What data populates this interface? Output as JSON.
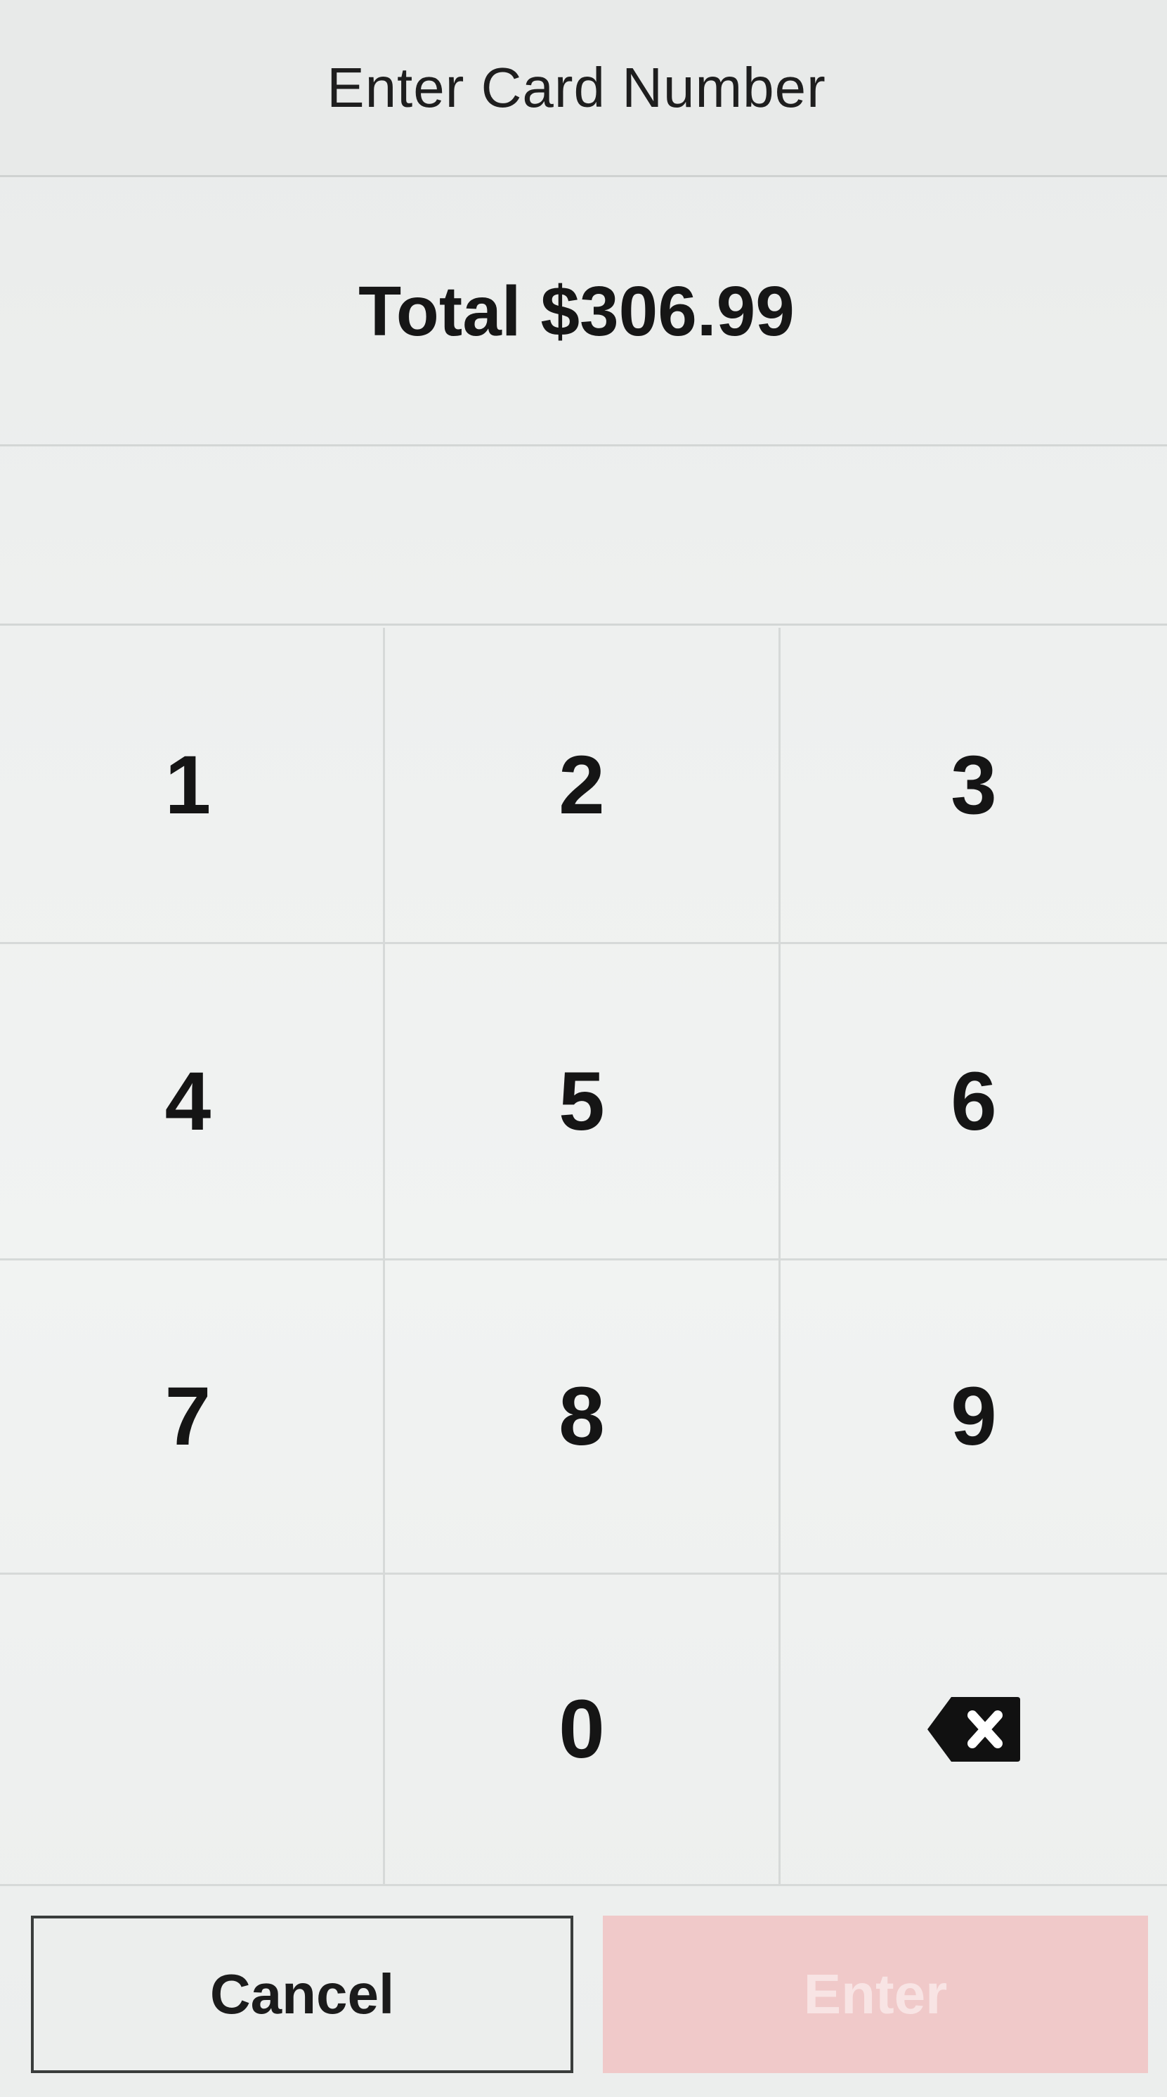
{
  "header": {
    "title": "Enter Card Number"
  },
  "summary": {
    "total": "Total $306.99"
  },
  "card_input": {
    "value": ""
  },
  "keypad": {
    "keys": [
      "1",
      "2",
      "3",
      "4",
      "5",
      "6",
      "7",
      "8",
      "9",
      "",
      "0"
    ],
    "backspace_icon": "backspace-icon"
  },
  "actions": {
    "cancel_label": "Cancel",
    "enter_label": "Enter",
    "enter_disabled_color": "#f0c9c9"
  }
}
